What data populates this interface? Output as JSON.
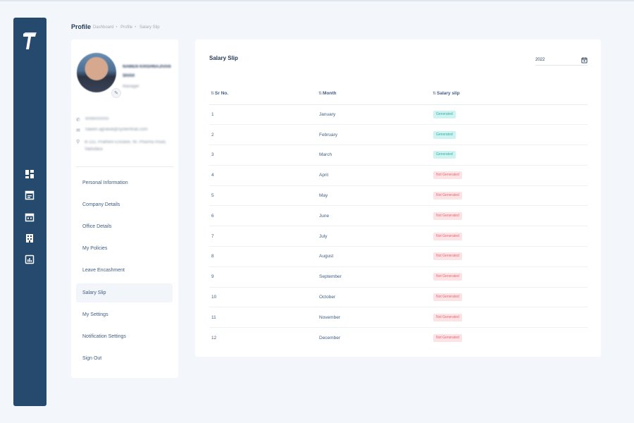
{
  "header": {
    "title": "Profile",
    "breadcrumb": [
      "Dashboard",
      "Profile",
      "Salary Slip"
    ]
  },
  "colors": {
    "sidebar": "#264a6e",
    "generated_bg": "#cdf4f0",
    "not_generated_bg": "#fde3e5"
  },
  "icons": [
    "logo-t",
    "dashboard-icon",
    "document-icon",
    "calendar-icon",
    "building-icon",
    "chart-icon"
  ],
  "profile": {
    "name": "NAWEN KRISHNAJIVAN SHAH",
    "role": "Manager",
    "phone": "9099000000",
    "email": "nawen.agrawal@systemtrak.com",
    "address": "B-115, Prathem Enclave, Nr. Pharma Road, Vadodara"
  },
  "menu": [
    {
      "label": "Personal Information",
      "active": false
    },
    {
      "label": "Company Details",
      "active": false
    },
    {
      "label": "Office Details",
      "active": false
    },
    {
      "label": "My Policies",
      "active": false
    },
    {
      "label": "Leave Encashment",
      "active": false
    },
    {
      "label": "Salary Slip",
      "active": true
    },
    {
      "label": "My Settings",
      "active": false
    },
    {
      "label": "Notification Settings",
      "active": false
    },
    {
      "label": "Sign Out",
      "active": false
    }
  ],
  "salary_slip": {
    "title": "Salary Slip",
    "year": "2022",
    "columns": {
      "sr": "Sr No.",
      "month": "Month",
      "slip": "Salary slip"
    },
    "rows": [
      {
        "sr": "1",
        "month": "January",
        "status": "Generated"
      },
      {
        "sr": "2",
        "month": "February",
        "status": "Generated"
      },
      {
        "sr": "3",
        "month": "March",
        "status": "Generated"
      },
      {
        "sr": "4",
        "month": "April",
        "status": "Not Generated"
      },
      {
        "sr": "5",
        "month": "May",
        "status": "Not Generated"
      },
      {
        "sr": "6",
        "month": "June",
        "status": "Not Generated"
      },
      {
        "sr": "7",
        "month": "July",
        "status": "Not Generated"
      },
      {
        "sr": "8",
        "month": "August",
        "status": "Not Generated"
      },
      {
        "sr": "9",
        "month": "September",
        "status": "Not Generated"
      },
      {
        "sr": "10",
        "month": "October",
        "status": "Not Generated"
      },
      {
        "sr": "11",
        "month": "November",
        "status": "Not Generated"
      },
      {
        "sr": "12",
        "month": "December",
        "status": "Not Generated"
      }
    ]
  }
}
